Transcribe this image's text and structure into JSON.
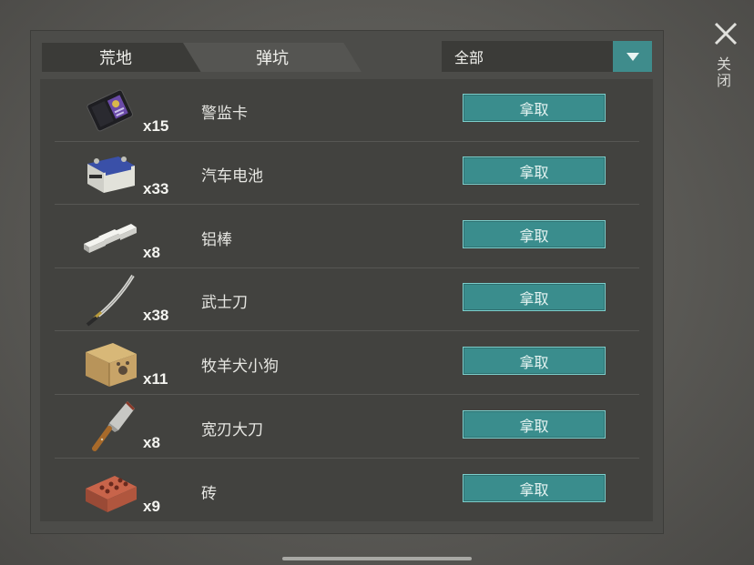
{
  "tabs": [
    {
      "label": "荒地"
    },
    {
      "label": "弹坑"
    }
  ],
  "filter": {
    "selected": "全部"
  },
  "close": {
    "label": "关闭"
  },
  "items": [
    {
      "name": "警监卡",
      "count": "x15",
      "icon": "badge-card-icon",
      "button": "拿取"
    },
    {
      "name": "汽车电池",
      "count": "x33",
      "icon": "car-battery-icon",
      "button": "拿取"
    },
    {
      "name": "铝棒",
      "count": "x8",
      "icon": "aluminum-bar-icon",
      "button": "拿取"
    },
    {
      "name": "武士刀",
      "count": "x38",
      "icon": "katana-icon",
      "button": "拿取"
    },
    {
      "name": "牧羊犬小狗",
      "count": "x11",
      "icon": "puppy-box-icon",
      "button": "拿取"
    },
    {
      "name": "宽刃大刀",
      "count": "x8",
      "icon": "cleaver-icon",
      "button": "拿取"
    },
    {
      "name": "砖",
      "count": "x9",
      "icon": "brick-icon",
      "button": "拿取"
    }
  ],
  "colors": {
    "accent": "#3a8d8d",
    "accent_border": "#7ccfcc"
  }
}
